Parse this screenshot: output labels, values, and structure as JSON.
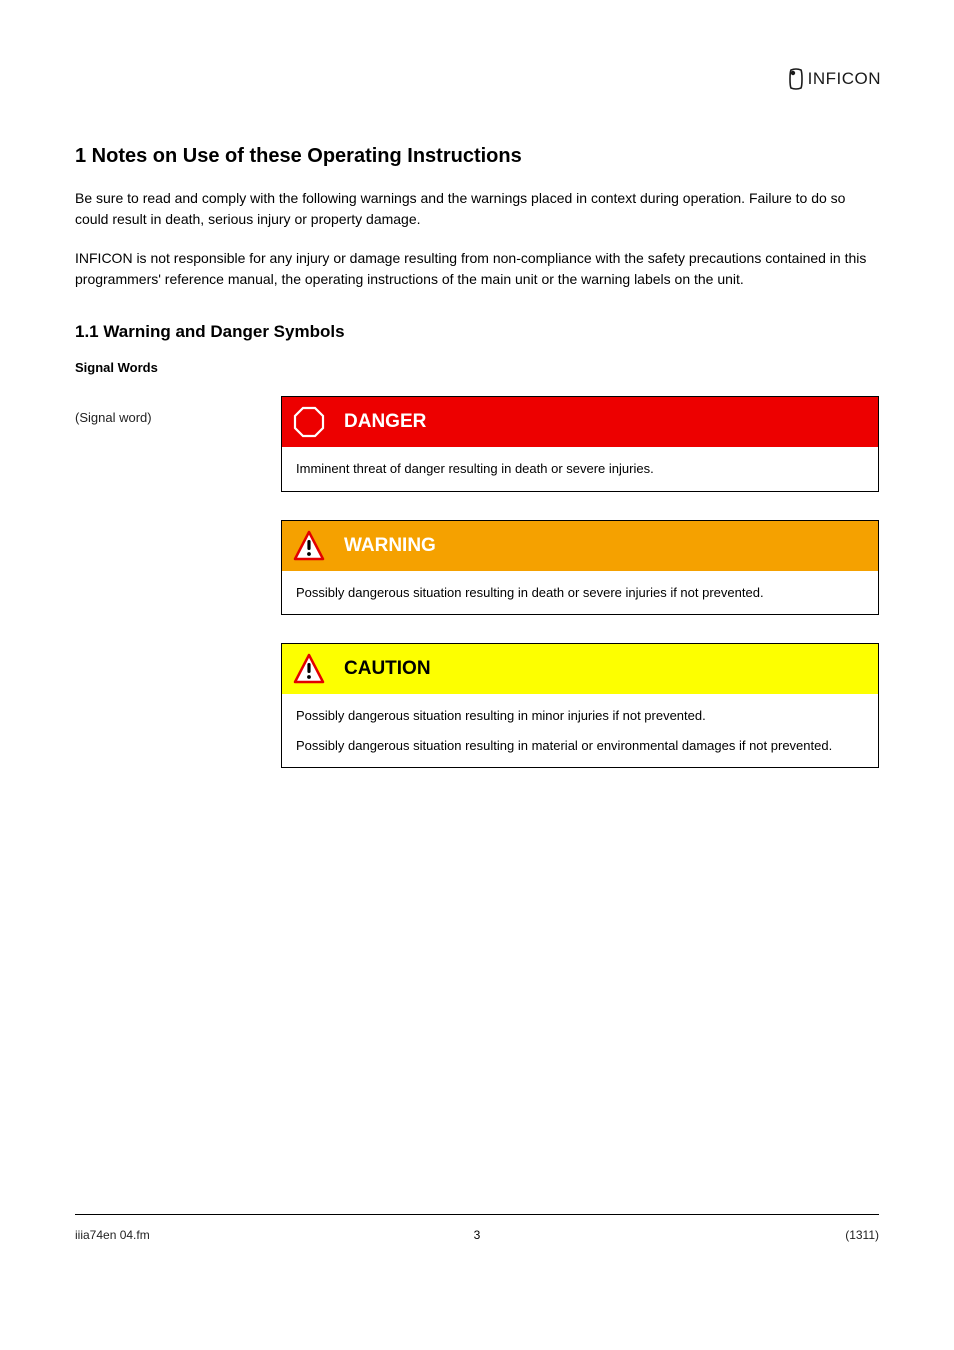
{
  "logo": {
    "brand": "INFICON"
  },
  "section": {
    "heading": "1 Notes on Use of these Operating Instructions",
    "subheading": "1.1 Warning and Danger Symbols",
    "intro1": "Be sure to read and comply with the following warnings and the warnings placed in context during operation. Failure to do so could result in death, serious injury or property damage.",
    "intro2": "INFICON is not responsible for any injury or damage resulting from non-compliance with the safety precautions contained in this programmers' reference manual, the operating instructions of the main unit or the warning labels on the unit.",
    "signal_words_label": "Signal Words"
  },
  "notices": {
    "danger": {
      "side_label": "(Signal word)",
      "title": "DANGER",
      "body": "Imminent threat of danger resulting in death or severe injuries."
    },
    "warning": {
      "title": "WARNING",
      "body": "Possibly dangerous situation resulting in death or severe injuries if not prevented."
    },
    "caution": {
      "title": "CAUTION",
      "body": "Possibly dangerous situation resulting in minor injuries if not prevented.",
      "body2": "Possibly dangerous situation resulting in material or environmental damages if not prevented."
    }
  },
  "footer": {
    "left": "iiia74en 04.fm",
    "right": "(1311)"
  },
  "page_number": "3"
}
